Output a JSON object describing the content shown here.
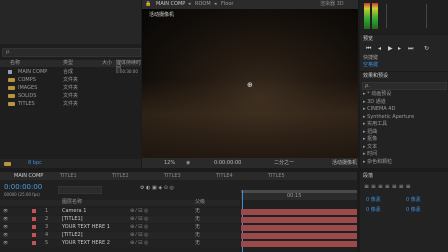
{
  "composition": {
    "breadcrumb": [
      "MAIN COMP",
      "ROOM",
      "Floor"
    ],
    "camera_label": "活动摄像机",
    "renderer": "渲染器 3D",
    "zoom": "12%",
    "timecode": "0:00:00:00",
    "view_mode": "二分之一",
    "camera_select": "活动摄像机",
    "views": "1个..."
  },
  "project": {
    "search_placeholder": "ρ.",
    "headers": [
      "名称",
      "类型",
      "大小",
      "媒体持续时间"
    ],
    "items": [
      {
        "name": "MAIN COMP",
        "type": "合成",
        "duration": "0:00:30:00",
        "icon": "comp-icon"
      },
      {
        "name": "COMPS",
        "type": "文件夹",
        "duration": "",
        "icon": "folder-icon"
      },
      {
        "name": "IMAGES",
        "type": "文件夹",
        "duration": "",
        "icon": "folder-icon"
      },
      {
        "name": "SOLIDS",
        "type": "文件夹",
        "duration": "",
        "icon": "folder-icon"
      },
      {
        "name": "TITLES",
        "type": "文件夹",
        "duration": "",
        "icon": "folder-icon"
      }
    ],
    "footer": "8 bpc"
  },
  "preview": {
    "title": "预览",
    "shortcut_label": "快捷键",
    "shortcut_value": "空格键"
  },
  "effects": {
    "title": "效果和预设",
    "search_placeholder": "ρ.",
    "items": [
      "* 动画预设",
      "3D 通道",
      "CINEMA 4D",
      "Synthetic Aperture",
      "实用工具",
      "扭曲",
      "抠像",
      "文本",
      "时间",
      "杂色和颗粒"
    ]
  },
  "timeline": {
    "tabs": [
      "MAIN COMP",
      "TITLE1",
      "TITLE2",
      "TITLE3",
      "TITLE4",
      "TITLE5"
    ],
    "timecode": "0:00:00:00",
    "fps": "00000 (25.00 fps)",
    "header_name": "图层名称",
    "header_parent": "父级",
    "ruler_mark": "00:15",
    "layers": [
      {
        "num": "1",
        "name": "Camera 1",
        "parent": "无",
        "color": "#c25555"
      },
      {
        "num": "2",
        "name": "[TITLE1]",
        "parent": "无",
        "color": "#c25555"
      },
      {
        "num": "3",
        "name": "YOUR TEXT HERE 1",
        "parent": "无",
        "color": "#c25555"
      },
      {
        "num": "4",
        "name": "[TITLE2]",
        "parent": "无",
        "color": "#c25555"
      },
      {
        "num": "5",
        "name": "YOUR TEXT HERE 2",
        "parent": "无",
        "color": "#c25555"
      }
    ]
  },
  "paragraph": {
    "title": "段落",
    "values": [
      "0 像素",
      "0 像素",
      "0 像素",
      "0 像素"
    ]
  },
  "colors": {
    "accent_blue": "#3d8fd6",
    "track_red": "#9a4a4a",
    "timecode_blue": "#4a9ee6"
  }
}
